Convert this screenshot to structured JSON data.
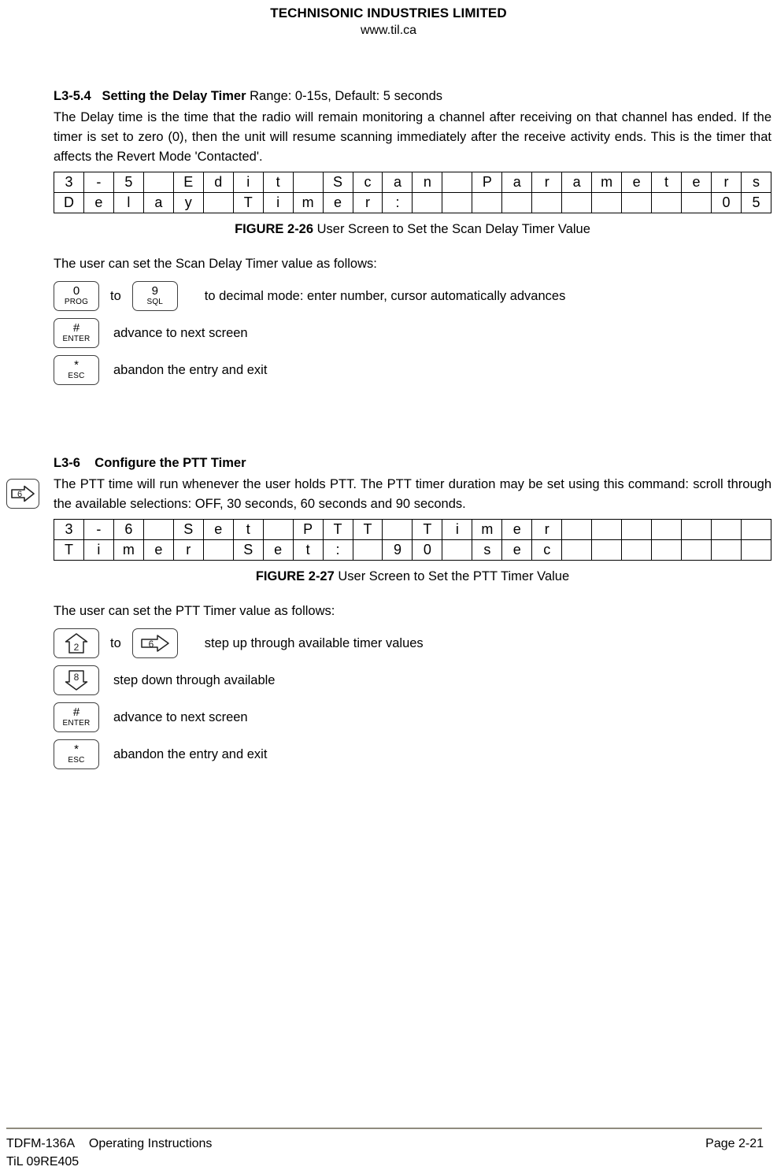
{
  "header": {
    "company": "TECHNISONIC INDUSTRIES LIMITED",
    "website": "www.til.ca"
  },
  "section_delay": {
    "number": "L3-5.4",
    "title": "Setting the Delay Timer",
    "subtitle": " Range: 0-15s, Default: 5 seconds",
    "paragraph": "The Delay time is the time that the radio will remain monitoring a channel after receiving on that channel has ended. If the timer is set to zero (0), then the unit will resume scanning immediately after the receive activity ends. This is the timer that affects the Revert Mode 'Contacted'.",
    "screen_table": {
      "columns": 24,
      "rows": [
        [
          "3",
          "-",
          "5",
          "",
          "E",
          "d",
          "i",
          "t",
          "",
          "S",
          "c",
          "a",
          "n",
          "",
          "P",
          "a",
          "r",
          "a",
          "m",
          "e",
          "t",
          "e",
          "r",
          "s"
        ],
        [
          "D",
          "e",
          "l",
          "a",
          "y",
          "",
          "T",
          "i",
          "m",
          "e",
          "r",
          ":",
          "",
          "",
          "",
          "",
          "",
          "",
          "",
          "",
          "",
          "",
          "0",
          "5"
        ]
      ]
    },
    "figure_caption": {
      "number": "FIGURE 2-26",
      "text": " User Screen to Set the Scan Delay Timer Value"
    },
    "intro": "The user can set the Scan Delay Timer value as follows:",
    "keys": [
      {
        "type": "range",
        "from": {
          "num": "0",
          "label": "PROG",
          "icon": "key-0-prog-icon"
        },
        "joiner": "to",
        "to": {
          "num": "9",
          "label": "SQL",
          "icon": "key-9-sql-icon"
        },
        "desc": "to decimal mode: enter number, cursor automatically advances"
      },
      {
        "type": "single",
        "key": {
          "num": "#",
          "label": "ENTER",
          "icon": "key-hash-enter-icon"
        },
        "desc": "advance to next screen"
      },
      {
        "type": "single",
        "key": {
          "num": "*",
          "label": "ESC",
          "icon": "key-star-esc-icon"
        },
        "desc": "abandon the entry and exit"
      }
    ]
  },
  "section_ptt": {
    "margin_icon": {
      "num": "6",
      "direction": "right",
      "icon": "key-6-right-arrow-icon"
    },
    "number": "L3-6",
    "title": "Configure the PTT Timer",
    "paragraph": "The PTT time will run whenever the user holds PTT. The PTT timer duration may be set using this command: scroll through the available selections: OFF, 30 seconds, 60 seconds and 90 seconds.",
    "screen_table": {
      "columns": 24,
      "rows": [
        [
          "3",
          "-",
          "6",
          "",
          "S",
          "e",
          "t",
          "",
          "P",
          "T",
          "T",
          "",
          "T",
          "i",
          "m",
          "e",
          "r",
          "",
          "",
          "",
          "",
          "",
          "",
          ""
        ],
        [
          "T",
          "i",
          "m",
          "e",
          "r",
          "",
          "S",
          "e",
          "t",
          ":",
          "",
          "9",
          "0",
          "",
          "s",
          "e",
          "c",
          "",
          "",
          "",
          "",
          "",
          "",
          ""
        ]
      ]
    },
    "figure_caption": {
      "number": "FIGURE 2-27",
      "text": " User Screen to Set the PTT Timer Value"
    },
    "intro": "The user can set the PTT Timer value as follows:",
    "keys": [
      {
        "type": "range",
        "from": {
          "num": "2",
          "direction": "up",
          "icon": "key-2-up-arrow-icon"
        },
        "joiner": "to",
        "to": {
          "num": "6",
          "direction": "right",
          "icon": "key-6-right-arrow-icon"
        },
        "desc": "step up through available timer values"
      },
      {
        "type": "single-arrow",
        "key": {
          "num": "8",
          "direction": "down",
          "icon": "key-8-down-arrow-icon"
        },
        "desc": "step down through available"
      },
      {
        "type": "single",
        "key": {
          "num": "#",
          "label": "ENTER",
          "icon": "key-hash-enter-icon"
        },
        "desc": "advance to next screen"
      },
      {
        "type": "single",
        "key": {
          "num": "*",
          "label": "ESC",
          "icon": "key-star-esc-icon"
        },
        "desc": "abandon the entry and exit"
      }
    ]
  },
  "footer": {
    "model": "TDFM-136A",
    "doc_type": "Operating Instructions",
    "page": "Page 2-21",
    "revision": "TiL 09RE405",
    "rule_color": "#8f8b7e"
  }
}
